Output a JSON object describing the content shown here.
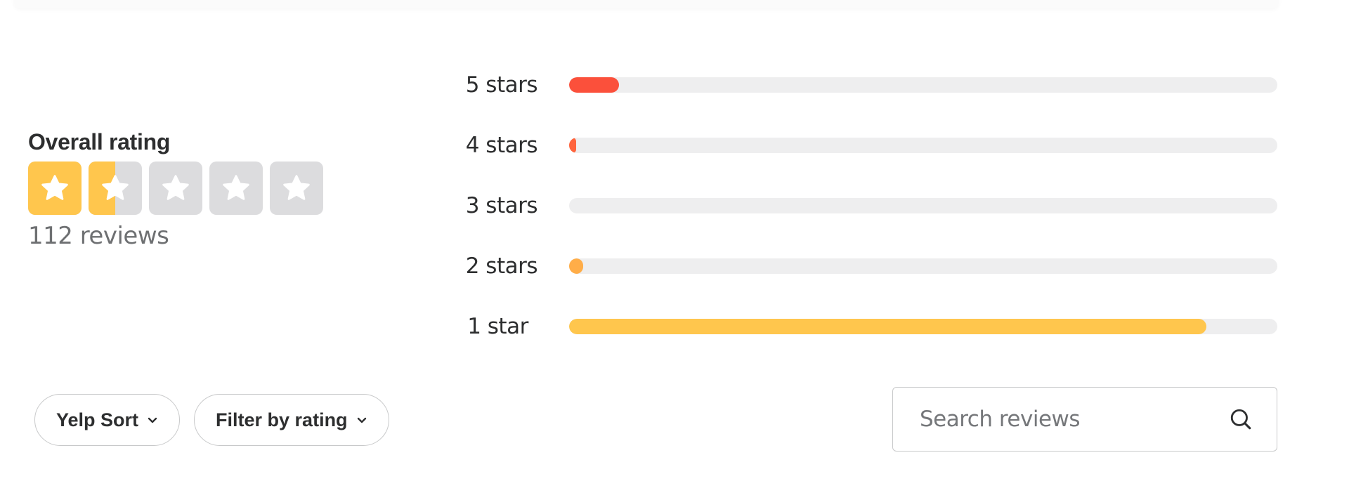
{
  "overall": {
    "title": "Overall rating",
    "rating": 1.5,
    "max_stars": 5,
    "review_count_label": "112 reviews",
    "star_color": "#ffc64d",
    "empty_star_color": "#dcdcde"
  },
  "distribution": {
    "rows": [
      {
        "label": "5 stars",
        "percent": 7,
        "color": "#fb503b"
      },
      {
        "label": "4 stars",
        "percent": 1,
        "color": "#ff643d"
      },
      {
        "label": "3 stars",
        "percent": 0,
        "color": "#ff8742"
      },
      {
        "label": "2 stars",
        "percent": 2,
        "color": "#ffad48"
      },
      {
        "label": "1 star",
        "percent": 90,
        "color": "#ffc64d"
      }
    ],
    "track_color": "#eeeeef"
  },
  "controls": {
    "sort_label": "Yelp Sort",
    "filter_label": "Filter by rating"
  },
  "search": {
    "placeholder": "Search reviews",
    "value": ""
  }
}
